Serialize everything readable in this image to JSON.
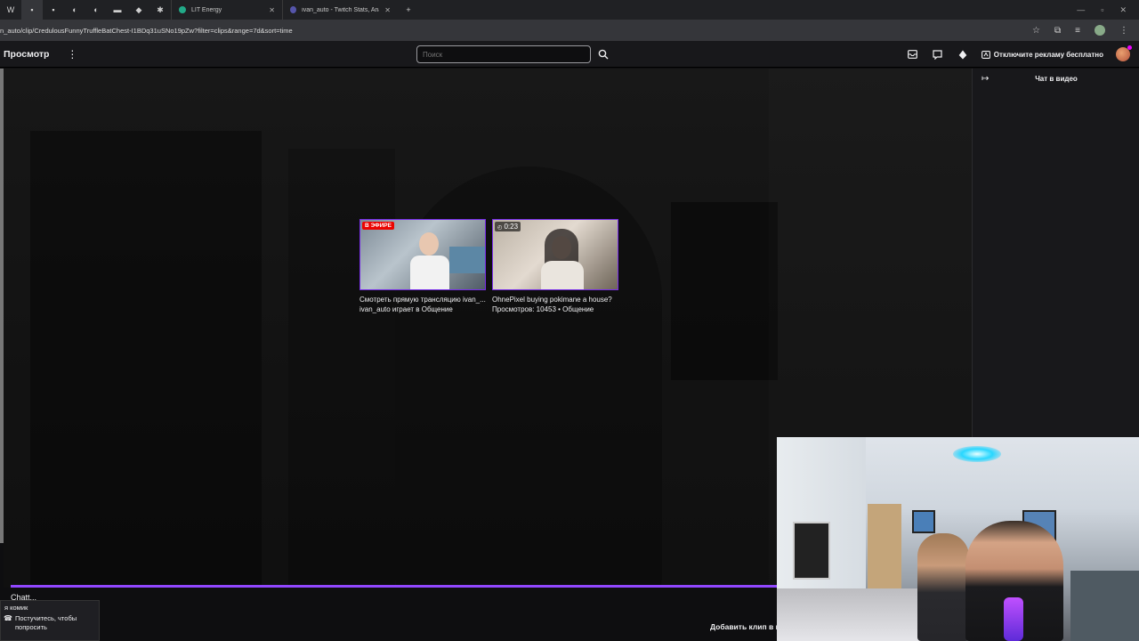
{
  "browser": {
    "tabs": [
      {
        "label": "LIT Energy"
      },
      {
        "label": "ivan_auto - Twitch Stats, Analyt"
      }
    ],
    "url": "n_auto/clip/CredulousFunnyTruffleBatChest-I1BDq31uSNo19pZw?filter=clips&range=7d&sort=time"
  },
  "nav": {
    "browse_label": "Просмотр",
    "search_placeholder": "Поиск",
    "ad_free_label": "Отключите рекламу бесплатно"
  },
  "chat": {
    "title": "Чат в видео"
  },
  "recommendations": [
    {
      "badge": "В ЭФИРЕ",
      "title": "Смотреть прямую трансляцию ivan_...",
      "subtitle": "ivan_auto играет в Общение"
    },
    {
      "badge": "0:23",
      "title": "OhnePixel buying pokimane a house?",
      "subtitle": "Просмотров: 10453 • Общение"
    }
  ],
  "player": {
    "clip_title": "Chatt..."
  },
  "toast": {
    "heading": "я комик",
    "body": "Постучитесь, чтобы попросить"
  },
  "footer": {
    "add_clip_label": "Добавить клип в и"
  },
  "colors": {
    "accent": "#9147ff",
    "live": "#eb0400",
    "background": "#0e0e10",
    "panel": "#18181b"
  }
}
